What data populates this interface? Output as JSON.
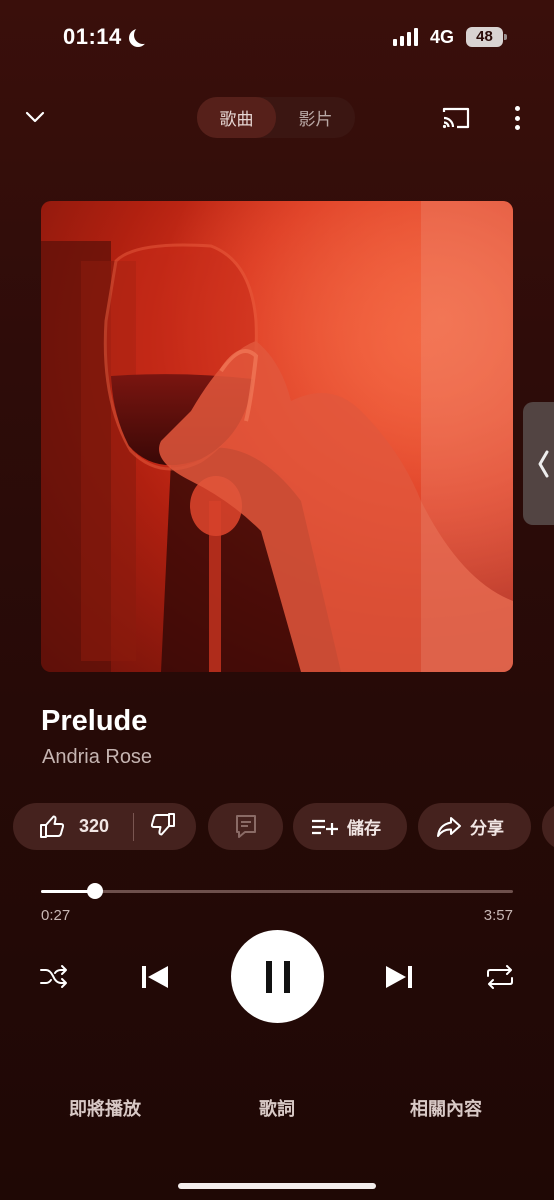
{
  "status_bar": {
    "time": "01:14",
    "network": "4G",
    "battery": "48"
  },
  "top_bar": {
    "segments": [
      "歌曲",
      "影片"
    ],
    "active_segment": "歌曲"
  },
  "track": {
    "title": "Prelude",
    "artist": "Andria Rose"
  },
  "actions": {
    "like_count": "320",
    "save_label": "儲存",
    "share_label": "分享"
  },
  "progress": {
    "current": "0:27",
    "duration": "3:57",
    "fraction": 0.114
  },
  "bottom_tabs": {
    "up_next": "即將播放",
    "lyrics": "歌詞",
    "related": "相關內容"
  },
  "colors": {
    "background": "#2a0b08",
    "chip": "#45221e",
    "artwork_accent": "#d8331d"
  },
  "icons": {
    "collapse": "chevron-down-icon",
    "cast": "cast-icon",
    "more": "more-vertical-icon",
    "like": "thumbs-up-icon",
    "dislike": "thumbs-down-icon",
    "comment": "comment-icon",
    "save": "playlist-add-icon",
    "share": "share-icon",
    "shuffle": "shuffle-icon",
    "previous": "skip-previous-icon",
    "pause": "pause-icon",
    "next": "skip-next-icon",
    "repeat": "repeat-icon"
  }
}
